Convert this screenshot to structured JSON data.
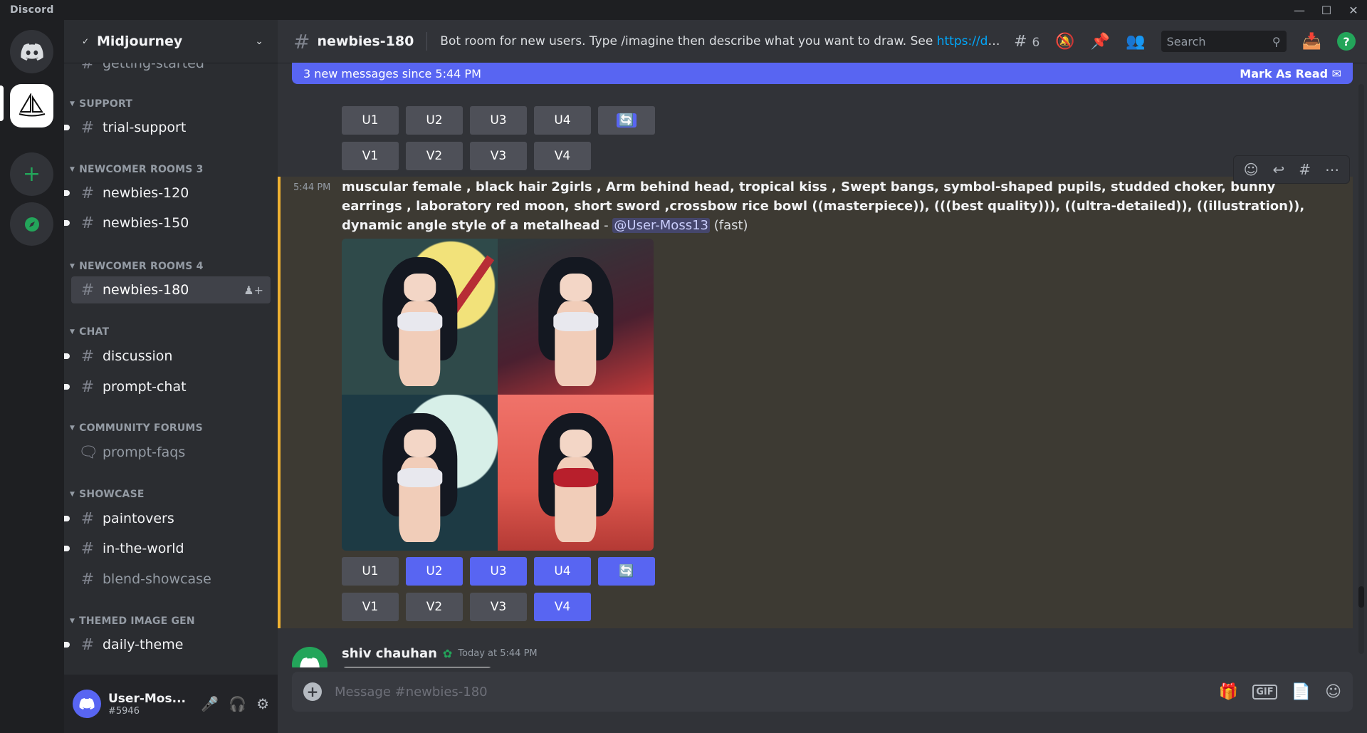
{
  "window": {
    "title": "Discord"
  },
  "server": {
    "name": "Midjourney"
  },
  "sidebar": {
    "partial_channel": "getting-started",
    "categories": [
      {
        "label": "SUPPORT"
      },
      {
        "label": "NEWCOMER ROOMS 3"
      },
      {
        "label": "NEWCOMER ROOMS 4"
      },
      {
        "label": "CHAT"
      },
      {
        "label": "COMMUNITY FORUMS"
      },
      {
        "label": "SHOWCASE"
      },
      {
        "label": "THEMED IMAGE GEN"
      }
    ],
    "channels": [
      {
        "label": "trial-support"
      },
      {
        "label": "newbies-120"
      },
      {
        "label": "newbies-150"
      },
      {
        "label": "newbies-180"
      },
      {
        "label": "discussion"
      },
      {
        "label": "prompt-chat"
      },
      {
        "label": "prompt-faqs"
      },
      {
        "label": "paintovers"
      },
      {
        "label": "in-the-world"
      },
      {
        "label": "blend-showcase"
      },
      {
        "label": "daily-theme"
      }
    ]
  },
  "user": {
    "name": "User-Mos...",
    "tag": "#5946"
  },
  "topbar": {
    "channel": "newbies-180",
    "topic": "Bot room for new users. Type /imagine then describe what you want to draw. See ",
    "topic_link": "https://docs.midjourn...",
    "threads_count": "6",
    "search_placeholder": "Search"
  },
  "newbar": {
    "text": "3 new messages since 5:44 PM",
    "action": "Mark As Read"
  },
  "buttons": {
    "u1": "U1",
    "u2": "U2",
    "u3": "U3",
    "u4": "U4",
    "v1": "V1",
    "v2": "V2",
    "v3": "V3",
    "v4": "V4"
  },
  "message": {
    "time": "5:44 PM",
    "prompt": "muscular female , black hair 2girls , Arm behind head, tropical kiss , Swept bangs, symbol-shaped pupils, studded choker, bunny earrings , laboratory red moon, short sword ,crossbow rice bowl ((masterpiece)), (((best quality))), ((ultra-detailed)), ((illustration)), dynamic angle style of a metalhead",
    "dash": " - ",
    "mention": "@User-Moss13",
    "speed": " (fast)"
  },
  "message2": {
    "author": "shiv chauhan",
    "time": "Today at 5:44 PM"
  },
  "composer": {
    "placeholder": "Message #newbies-180",
    "gif_label": "GIF"
  },
  "colors": {
    "accent": "#5865f2",
    "highlight_border": "#f0b232",
    "online": "#23a55a"
  }
}
